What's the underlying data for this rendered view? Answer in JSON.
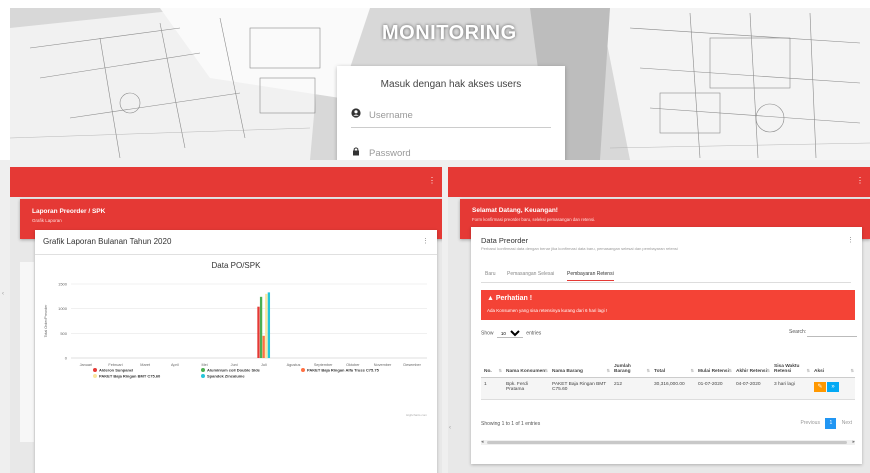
{
  "hero": {
    "title": "MONITORING",
    "login_title": "Masuk dengan hak akses users",
    "username_placeholder": "Username",
    "password_placeholder": "Password"
  },
  "left_panel": {
    "header_title": "Laporan Preorder / SPK",
    "header_sub": "Grafik Laporan",
    "card_title": "Grafik Laporan Bulanan Tahun 2020",
    "menu_icon": "more-vert-icon"
  },
  "chart_data": {
    "type": "bar",
    "title": "Data PO/SPK",
    "ylabel": "Total Order/Preorder",
    "ylim": [
      0,
      1500
    ],
    "yticks": [
      "0",
      "500",
      "1000",
      "1500"
    ],
    "credit": "Highcharts.com",
    "categories": [
      "Januari",
      "Februari",
      "Maret",
      "April",
      "Mei",
      "Juni",
      "Juli",
      "Agustus",
      "September",
      "Oktober",
      "November",
      "Desember"
    ],
    "series": [
      {
        "name": "Alderon Sunpanel",
        "color": "#e53935",
        "values": [
          0,
          0,
          0,
          0,
          0,
          0,
          1040,
          0,
          0,
          0,
          0,
          0
        ]
      },
      {
        "name": "Aluminium coil Double Side",
        "color": "#4caf50",
        "values": [
          0,
          0,
          0,
          0,
          0,
          0,
          1240,
          0,
          0,
          0,
          0,
          0
        ]
      },
      {
        "name": "PAKET Baja Ringan Alfa Truss C75.75",
        "color": "#ff7043",
        "values": [
          0,
          0,
          0,
          0,
          0,
          0,
          450,
          0,
          0,
          0,
          0,
          0
        ]
      },
      {
        "name": "PAKET Baja Ringan BMT C75.60",
        "color": "#f9e79f",
        "values": [
          0,
          0,
          0,
          0,
          0,
          0,
          1300,
          0,
          0,
          0,
          0,
          0
        ]
      },
      {
        "name": "Spandek Zincalume",
        "color": "#26c6da",
        "values": [
          0,
          0,
          0,
          0,
          0,
          0,
          1330,
          0,
          0,
          0,
          0,
          0
        ]
      }
    ]
  },
  "right_panel": {
    "header_title": "Selamat Datang, Keuangan!",
    "header_sub": "Form konfirmasi preorder baru, seleksi pemasangan dan retensi.",
    "card_title": "Data Preorder",
    "card_sub": "Perbarui konfirmasi data dengan benar jika konfirmasi data baru, pemasangan selesai dan pembayaran retensi",
    "tabs": [
      {
        "label": "Baru",
        "active": false
      },
      {
        "label": "Pemasangan Selesai",
        "active": false
      },
      {
        "label": "Pembayaran Retensi",
        "active": true
      }
    ],
    "alert_title": "Perhatian !",
    "alert_msg": "Ada Konsumen yang sisa retensinya kurang dari 6 hari lagi !",
    "show_label": "Show",
    "show_value": "10",
    "entries_label": "entries",
    "search_label": "Search:",
    "columns": [
      "No.",
      "Nama Konsumen",
      "Nama Barang",
      "Jumlah Barang",
      "Total",
      "Mulai Retensi",
      "Akhir Retensi",
      "Sisa Waktu Retensi",
      "Aksi"
    ],
    "rows": [
      [
        "1",
        "Bpk. Ferdi Pratama",
        "PAKET Baja Ringan BMT C75.60",
        "212",
        "30,316,000.00",
        "01-07-2020",
        "04-07-2020",
        "3 hari lagi"
      ]
    ],
    "showing": "Showing 1 to 1 of 1 entries",
    "pager_prev": "Previous",
    "pager_page": "1",
    "pager_next": "Next"
  }
}
